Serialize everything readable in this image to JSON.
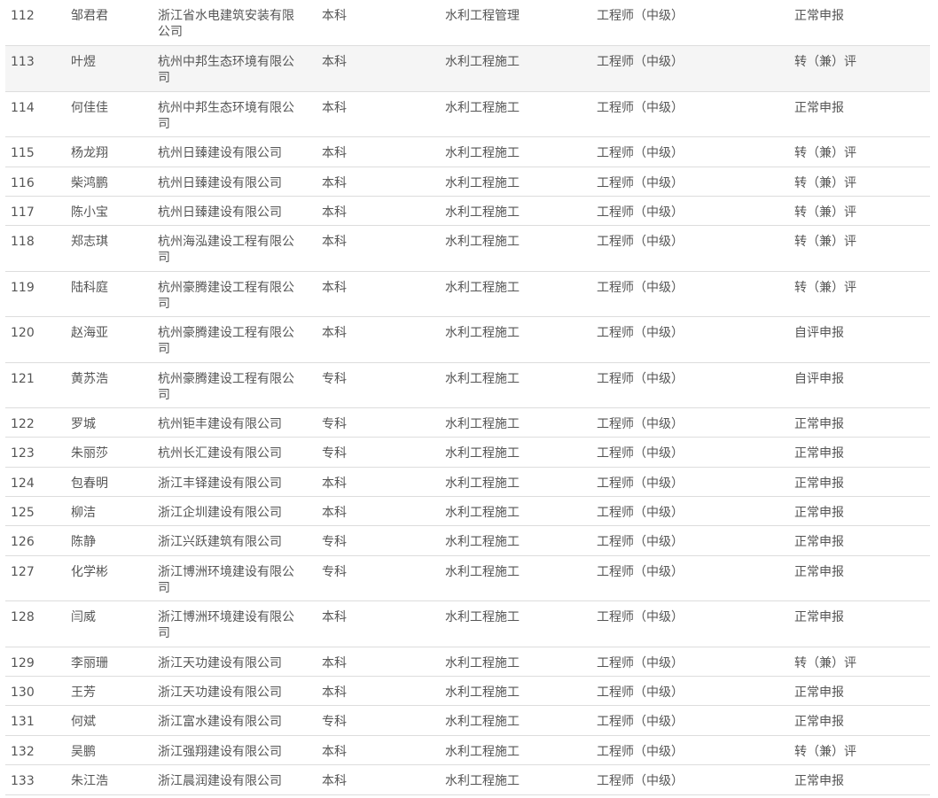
{
  "rows": [
    {
      "no": "112",
      "name": "邹君君",
      "company": "浙江省水电建筑安装有限公司",
      "education": "本科",
      "major": "水利工程管理",
      "title": "工程师（中级）",
      "type": "正常申报"
    },
    {
      "no": "113",
      "name": "叶煜",
      "company": "杭州中邦生态环境有限公司",
      "education": "本科",
      "major": "水利工程施工",
      "title": "工程师（中级）",
      "type": "转（兼）评"
    },
    {
      "no": "114",
      "name": "何佳佳",
      "company": "杭州中邦生态环境有限公司",
      "education": "本科",
      "major": "水利工程施工",
      "title": "工程师（中级）",
      "type": "正常申报"
    },
    {
      "no": "115",
      "name": "杨龙翔",
      "company": "杭州日臻建设有限公司",
      "education": "本科",
      "major": "水利工程施工",
      "title": "工程师（中级）",
      "type": "转（兼）评"
    },
    {
      "no": "116",
      "name": "柴鸿鹏",
      "company": "杭州日臻建设有限公司",
      "education": "本科",
      "major": "水利工程施工",
      "title": "工程师（中级）",
      "type": "转（兼）评"
    },
    {
      "no": "117",
      "name": "陈小宝",
      "company": "杭州日臻建设有限公司",
      "education": "本科",
      "major": "水利工程施工",
      "title": "工程师（中级）",
      "type": "转（兼）评"
    },
    {
      "no": "118",
      "name": "郑志琪",
      "company": "杭州海泓建设工程有限公司",
      "education": "本科",
      "major": "水利工程施工",
      "title": "工程师（中级）",
      "type": "转（兼）评"
    },
    {
      "no": "119",
      "name": "陆科庭",
      "company": "杭州豪腾建设工程有限公司",
      "education": "本科",
      "major": "水利工程施工",
      "title": "工程师（中级）",
      "type": "转（兼）评"
    },
    {
      "no": "120",
      "name": "赵海亚",
      "company": "杭州豪腾建设工程有限公司",
      "education": "本科",
      "major": "水利工程施工",
      "title": "工程师（中级）",
      "type": "自评申报"
    },
    {
      "no": "121",
      "name": "黄苏浩",
      "company": "杭州豪腾建设工程有限公司",
      "education": "专科",
      "major": "水利工程施工",
      "title": "工程师（中级）",
      "type": "自评申报"
    },
    {
      "no": "122",
      "name": "罗城",
      "company": "杭州钜丰建设有限公司",
      "education": "专科",
      "major": "水利工程施工",
      "title": "工程师（中级）",
      "type": "正常申报"
    },
    {
      "no": "123",
      "name": "朱丽莎",
      "company": "杭州长汇建设有限公司",
      "education": "专科",
      "major": "水利工程施工",
      "title": "工程师（中级）",
      "type": "正常申报"
    },
    {
      "no": "124",
      "name": "包春明",
      "company": "浙江丰铎建设有限公司",
      "education": "本科",
      "major": "水利工程施工",
      "title": "工程师（中级）",
      "type": "正常申报"
    },
    {
      "no": "125",
      "name": "柳洁",
      "company": "浙江企圳建设有限公司",
      "education": "本科",
      "major": "水利工程施工",
      "title": "工程师（中级）",
      "type": "正常申报"
    },
    {
      "no": "126",
      "name": "陈静",
      "company": "浙江兴跃建筑有限公司",
      "education": "专科",
      "major": "水利工程施工",
      "title": "工程师（中级）",
      "type": "正常申报"
    },
    {
      "no": "127",
      "name": "化学彬",
      "company": "浙江博洲环境建设有限公司",
      "education": "专科",
      "major": "水利工程施工",
      "title": "工程师（中级）",
      "type": "正常申报"
    },
    {
      "no": "128",
      "name": "闫威",
      "company": "浙江博洲环境建设有限公司",
      "education": "本科",
      "major": "水利工程施工",
      "title": "工程师（中级）",
      "type": "正常申报"
    },
    {
      "no": "129",
      "name": "李丽珊",
      "company": "浙江天功建设有限公司",
      "education": "本科",
      "major": "水利工程施工",
      "title": "工程师（中级）",
      "type": "转（兼）评"
    },
    {
      "no": "130",
      "name": "王芳",
      "company": "浙江天功建设有限公司",
      "education": "本科",
      "major": "水利工程施工",
      "title": "工程师（中级）",
      "type": "正常申报"
    },
    {
      "no": "131",
      "name": "何斌",
      "company": "浙江富水建设有限公司",
      "education": "专科",
      "major": "水利工程施工",
      "title": "工程师（中级）",
      "type": "正常申报"
    },
    {
      "no": "132",
      "name": "吴鹏",
      "company": "浙江强翔建设有限公司",
      "education": "本科",
      "major": "水利工程施工",
      "title": "工程师（中级）",
      "type": "转（兼）评"
    },
    {
      "no": "133",
      "name": "朱江浩",
      "company": "浙江晨润建设有限公司",
      "education": "本科",
      "major": "水利工程施工",
      "title": "工程师（中级）",
      "type": "正常申报"
    }
  ]
}
